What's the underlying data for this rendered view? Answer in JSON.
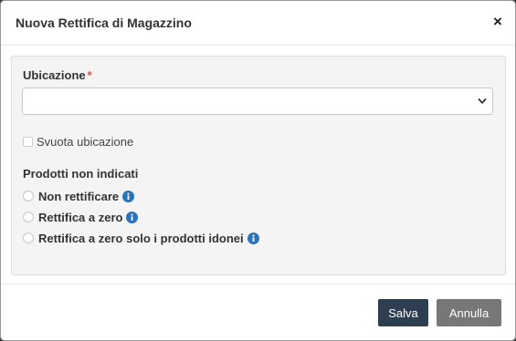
{
  "modal": {
    "title": "Nuova Rettifica di Magazzino",
    "close_label": "×"
  },
  "form": {
    "location": {
      "label": "Ubicazione",
      "required_mark": "*",
      "selected_value": ""
    },
    "empty_location": {
      "label": "Svuota ubicazione",
      "checked": false
    },
    "unlisted_products": {
      "title": "Prodotti non indicati",
      "options": [
        {
          "label": "Non rettificare",
          "icon": "info-icon",
          "selected": false
        },
        {
          "label": "Rettifica a zero",
          "icon": "info-icon",
          "selected": false
        },
        {
          "label": "Rettifica a zero solo i prodotti idonei",
          "icon": "info-icon",
          "selected": false
        }
      ]
    }
  },
  "footer": {
    "save_label": "Salva",
    "cancel_label": "Annulla"
  },
  "colors": {
    "required": "#d9534f",
    "save_button": "#2c3e50",
    "cancel_button": "#777777",
    "info_icon": "#2a73b8",
    "panel_bg": "#f4f4f4"
  }
}
